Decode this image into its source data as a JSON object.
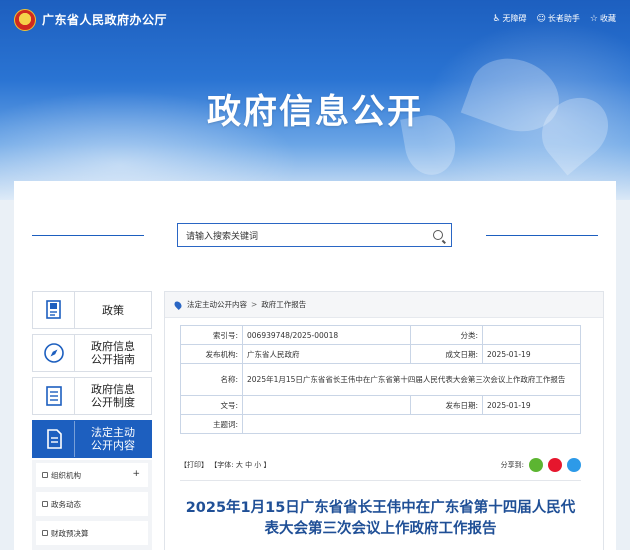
{
  "header": {
    "site_title": "广东省人民政府办公厅",
    "links": [
      {
        "label": "无障碍",
        "icon": "accessibility-icon"
      },
      {
        "label": "长者助手",
        "icon": "elder-helper-icon"
      },
      {
        "label": "收藏",
        "icon": "star-icon"
      }
    ],
    "icon_glyphs": {
      "accessibility": "♿",
      "elder": "☺",
      "star": "☆"
    },
    "banner_title": "政府信息公开"
  },
  "search": {
    "placeholder": "请输入搜索关键词"
  },
  "sidebar": {
    "items": [
      {
        "label_lines": [
          "政策"
        ],
        "icon": "policy-doc-icon"
      },
      {
        "label_lines": [
          "政府信息",
          "公开指南"
        ],
        "icon": "compass-icon"
      },
      {
        "label_lines": [
          "政府信息",
          "公开制度"
        ],
        "icon": "list-doc-icon"
      },
      {
        "label_lines": [
          "法定主动",
          "公开内容"
        ],
        "icon": "document-icon"
      }
    ],
    "sub_items": [
      "组织机构",
      "政务动态",
      "财政预决算"
    ],
    "expand_symbol": "+"
  },
  "breadcrumb": {
    "items": [
      "法定主动公开内容",
      "政府工作报告"
    ],
    "separator": ">"
  },
  "meta": {
    "index_label": "索引号:",
    "index_value": "006939748/2025-00018",
    "category_label": "分类:",
    "category_value": "",
    "publisher_label": "发布机构:",
    "publisher_value": "广东省人民政府",
    "created_label": "成文日期:",
    "created_value": "2025-01-19",
    "name_label": "名称:",
    "name_value": "2025年1月15日广东省省长王伟中在广东省第十四届人民代表大会第三次会议上作政府工作报告",
    "doc_no_label": "文号:",
    "doc_no_value": "",
    "published_label": "发布日期:",
    "published_value": "2025-01-19",
    "subject_label": "主题词:",
    "subject_value": ""
  },
  "tools": {
    "print": "【打印】",
    "font_label": "【字体:",
    "font_sizes": [
      "大",
      "中",
      "小"
    ],
    "font_close": "】",
    "share_label": "分享到:"
  },
  "share_colors": {
    "wechat": "#5cb531",
    "weibo": "#e6162d",
    "qq": "#2d9ae8"
  },
  "colors": {
    "accent": "#1d5fbf",
    "title_blue": "#1f4f96"
  },
  "article": {
    "title": "2025年1月15日广东省省长王伟中在广东省第十四届人民代表大会第三次会议上作政府工作报告"
  }
}
